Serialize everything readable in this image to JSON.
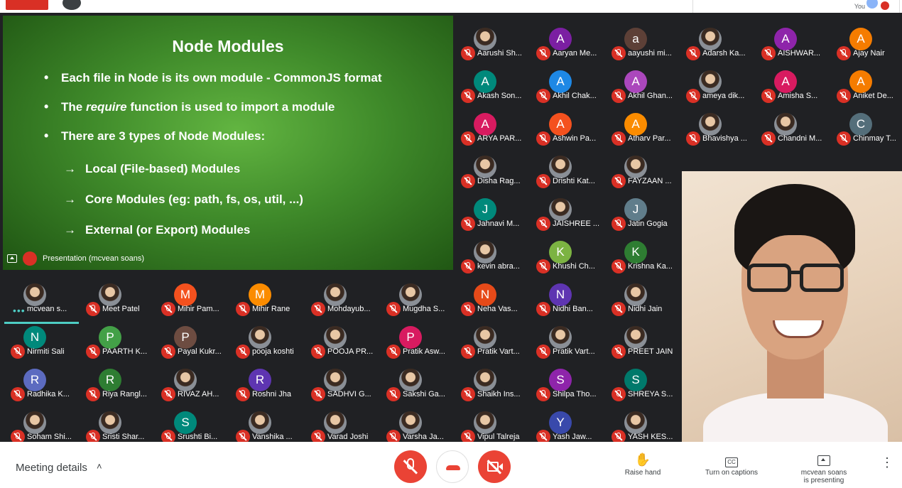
{
  "top": {
    "you_label": "You"
  },
  "slide": {
    "title": "Node Modules",
    "bullets": [
      {
        "pre": "Each file in Node is its own module - CommonJS format",
        "em": "",
        "post": ""
      },
      {
        "pre": "The ",
        "em": "require",
        "post": " function is used to import a module"
      },
      {
        "pre": "There are 3 types of Node Modules:",
        "em": "",
        "post": ""
      }
    ],
    "subs": [
      "Local (File-based) Modules",
      "Core Modules (eg: path, fs, os, util, ...)",
      "External (or Export) Modules"
    ],
    "presentation_label": "Presentation (mcvean soans)"
  },
  "participants": [
    {
      "name": "Aarushi Sh...",
      "letter": "",
      "color": "",
      "photo": true
    },
    {
      "name": "Aaryan Me...",
      "letter": "A",
      "color": "#7b1fa2",
      "photo": false
    },
    {
      "name": "aayushi mi...",
      "letter": "a",
      "color": "#5d4037",
      "photo": false
    },
    {
      "name": "Adarsh Ka...",
      "letter": "",
      "color": "",
      "photo": true
    },
    {
      "name": "AISHWAR...",
      "letter": "A",
      "color": "#8e24aa",
      "photo": false
    },
    {
      "name": "Ajay Nair",
      "letter": "A",
      "color": "#f57c00",
      "photo": false
    },
    {
      "name": "Akash Son...",
      "letter": "A",
      "color": "#00897b",
      "photo": false
    },
    {
      "name": "Akhil Chak...",
      "letter": "A",
      "color": "#1e88e5",
      "photo": false
    },
    {
      "name": "Akhil Ghan...",
      "letter": "A",
      "color": "#ab47bc",
      "photo": false
    },
    {
      "name": "ameya dik...",
      "letter": "",
      "color": "",
      "photo": true
    },
    {
      "name": "Amisha S...",
      "letter": "A",
      "color": "#d81b60",
      "photo": false
    },
    {
      "name": "Aniket De...",
      "letter": "A",
      "color": "#f57c00",
      "photo": false
    },
    {
      "name": "ARYA PAR...",
      "letter": "A",
      "color": "#d81b60",
      "photo": false
    },
    {
      "name": "Ashwin Pa...",
      "letter": "A",
      "color": "#f4511e",
      "photo": false
    },
    {
      "name": "Atharv Par...",
      "letter": "A",
      "color": "#fb8c00",
      "photo": false
    },
    {
      "name": "Bhavishya ...",
      "letter": "",
      "color": "",
      "photo": true
    },
    {
      "name": "Chandni M...",
      "letter": "",
      "color": "",
      "photo": true
    },
    {
      "name": "Chinmay T...",
      "letter": "C",
      "color": "#546e7a",
      "photo": false
    },
    {
      "name": "Disha Rag...",
      "letter": "",
      "color": "",
      "photo": true
    },
    {
      "name": "Drishti Kat...",
      "letter": "",
      "color": "",
      "photo": true
    },
    {
      "name": "FAYZAAN ...",
      "letter": "",
      "color": "",
      "photo": true
    },
    {
      "name": "Jahnavi M...",
      "letter": "J",
      "color": "#00897b",
      "photo": false
    },
    {
      "name": "JAISHREE ...",
      "letter": "",
      "color": "",
      "photo": true
    },
    {
      "name": "Jatin Gogia",
      "letter": "J",
      "color": "#607d8b",
      "photo": false
    },
    {
      "name": "kevin abra...",
      "letter": "",
      "color": "",
      "photo": true
    },
    {
      "name": "Khushi Ch...",
      "letter": "K",
      "color": "#7cb342",
      "photo": false
    },
    {
      "name": "Krishna Ka...",
      "letter": "K",
      "color": "#2e7d32",
      "photo": false
    },
    {
      "name": "mcvean s...",
      "letter": "",
      "color": "",
      "photo": true
    },
    {
      "name": "Meet Patel",
      "letter": "",
      "color": "",
      "photo": true
    },
    {
      "name": "Mihir Pam...",
      "letter": "M",
      "color": "#f4511e",
      "photo": false
    },
    {
      "name": "Mihir Rane",
      "letter": "M",
      "color": "#fb8c00",
      "photo": false
    },
    {
      "name": "Mohdayub...",
      "letter": "",
      "color": "",
      "photo": true
    },
    {
      "name": "Mugdha S...",
      "letter": "",
      "color": "",
      "photo": true
    },
    {
      "name": "Neha Vas...",
      "letter": "N",
      "color": "#e64a19",
      "photo": false
    },
    {
      "name": "Nidhi Ban...",
      "letter": "N",
      "color": "#5e35b1",
      "photo": false
    },
    {
      "name": "Nidhi Jain",
      "letter": "",
      "color": "",
      "photo": true
    },
    {
      "name": "Nirmiti Sali",
      "letter": "N",
      "color": "#00897b",
      "photo": false
    },
    {
      "name": "PAARTH K...",
      "letter": "P",
      "color": "#43a047",
      "photo": false
    },
    {
      "name": "Payal Kukr...",
      "letter": "P",
      "color": "#6d4c41",
      "photo": false
    },
    {
      "name": "pooja koshti",
      "letter": "",
      "color": "",
      "photo": true
    },
    {
      "name": "POOJA PR...",
      "letter": "",
      "color": "",
      "photo": true
    },
    {
      "name": "Pratik Asw...",
      "letter": "P",
      "color": "#d81b60",
      "photo": false
    },
    {
      "name": "Pratik Vart...",
      "letter": "",
      "color": "",
      "photo": true
    },
    {
      "name": "Pratik Vart...",
      "letter": "",
      "color": "",
      "photo": true
    },
    {
      "name": "PREET JAIN",
      "letter": "",
      "color": "",
      "photo": true
    },
    {
      "name": "Radhika K...",
      "letter": "R",
      "color": "#5c6bc0",
      "photo": false
    },
    {
      "name": "Riya Rangl...",
      "letter": "R",
      "color": "#2e7d32",
      "photo": false
    },
    {
      "name": "RIVAZ AH...",
      "letter": "",
      "color": "",
      "photo": true
    },
    {
      "name": "Roshni Jha",
      "letter": "R",
      "color": "#5e35b1",
      "photo": false
    },
    {
      "name": "SADHVI G...",
      "letter": "",
      "color": "",
      "photo": true
    },
    {
      "name": "Sakshi Ga...",
      "letter": "",
      "color": "",
      "photo": true
    },
    {
      "name": "Shaikh Ins...",
      "letter": "",
      "color": "",
      "photo": true
    },
    {
      "name": "Shilpa Tho...",
      "letter": "S",
      "color": "#8e24aa",
      "photo": false
    },
    {
      "name": "SHREYA S...",
      "letter": "S",
      "color": "#00796b",
      "photo": false
    },
    {
      "name": "Soham Shi...",
      "letter": "",
      "color": "",
      "photo": true
    },
    {
      "name": "Sristi Shar...",
      "letter": "",
      "color": "",
      "photo": true
    },
    {
      "name": "Srushti Bi...",
      "letter": "S",
      "color": "#00897b",
      "photo": false
    },
    {
      "name": "Vanshika ...",
      "letter": "",
      "color": "",
      "photo": true
    },
    {
      "name": "Varad Joshi",
      "letter": "",
      "color": "",
      "photo": true
    },
    {
      "name": "Varsha Ja...",
      "letter": "",
      "color": "",
      "photo": true
    },
    {
      "name": "Vipul Talreja",
      "letter": "",
      "color": "",
      "photo": true
    },
    {
      "name": "Yash Jaw...",
      "letter": "Y",
      "color": "#3949ab",
      "photo": false
    },
    {
      "name": "YASH KES...",
      "letter": "",
      "color": "",
      "photo": true
    }
  ],
  "controls": {
    "meeting_details": "Meeting details",
    "raise_hand": "Raise hand",
    "captions": "Turn on captions",
    "presenting_line1": "mcvean soans",
    "presenting_line2": "is presenting",
    "cc_glyph": "CC",
    "accent_red": "#ea4335"
  }
}
